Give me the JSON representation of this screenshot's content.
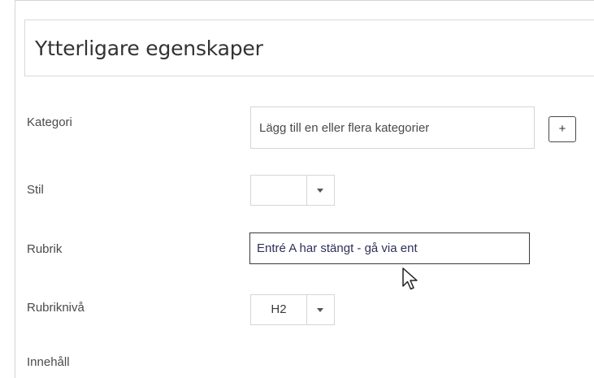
{
  "section": {
    "title": "Ytterligare egenskaper"
  },
  "fields": {
    "category": {
      "label": "Kategori",
      "placeholder": "Lägg till en eller flera kategorier",
      "add_label": "+"
    },
    "style": {
      "label": "Stil",
      "value": ""
    },
    "heading": {
      "label": "Rubrik",
      "value": "Entré A har stängt - gå via ent"
    },
    "heading_level": {
      "label": "Rubriknivå",
      "value": "H2"
    },
    "content": {
      "label": "Innehåll"
    }
  },
  "icons": {
    "dropdown": "caret-down-icon",
    "pointer": "mouse-pointer-icon"
  }
}
